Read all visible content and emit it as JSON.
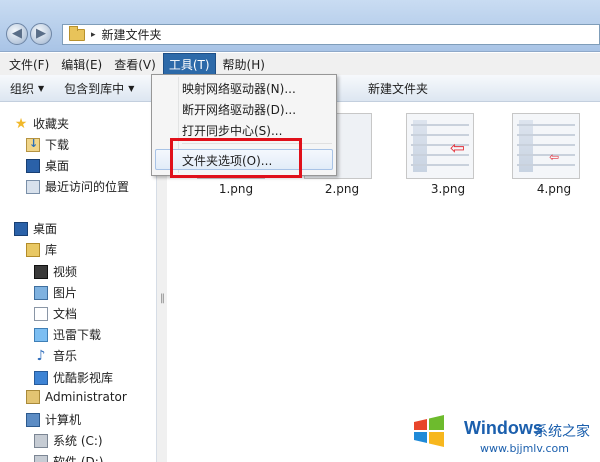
{
  "address": {
    "path_arrow": "▸",
    "path": "新建文件夹"
  },
  "nav": {
    "back": "◀",
    "forward": "▶"
  },
  "menubar": [
    {
      "label": "文件(F)"
    },
    {
      "label": "编辑(E)"
    },
    {
      "label": "查看(V)"
    },
    {
      "label": "工具(T)"
    },
    {
      "label": "帮助(H)"
    }
  ],
  "toolbar": {
    "organize": "组织",
    "include_library": "包含到库中",
    "new_folder": "新建文件夹"
  },
  "tools_menu": {
    "items": [
      "映射网络驱动器(N)...",
      "断开网络驱动器(D)...",
      "打开同步中心(S)...",
      "文件夹选项(O)..."
    ]
  },
  "sidebar": {
    "favorites": "收藏夹",
    "downloads": "下载",
    "desktop_fav": "桌面",
    "recent": "最近访问的位置",
    "desktop": "桌面",
    "library": "库",
    "video": "视频",
    "pictures": "图片",
    "documents": "文档",
    "xunlei": "迅雷下载",
    "music": "音乐",
    "youku": "优酷影视库",
    "admin": "Administrator",
    "computer": "计算机",
    "system_c": "系统 (C:)",
    "software_d": "软件 (D:)"
  },
  "files": [
    {
      "name": "1.png"
    },
    {
      "name": "2.png"
    },
    {
      "name": "3.png"
    },
    {
      "name": "4.png"
    }
  ],
  "watermark": {
    "title": "Windows",
    "subtitle": "系统之家",
    "url": "www.bjjmlv.com"
  },
  "colors": {
    "highlight_box": "#e0101a",
    "menu_active": "#2d6aa9"
  }
}
